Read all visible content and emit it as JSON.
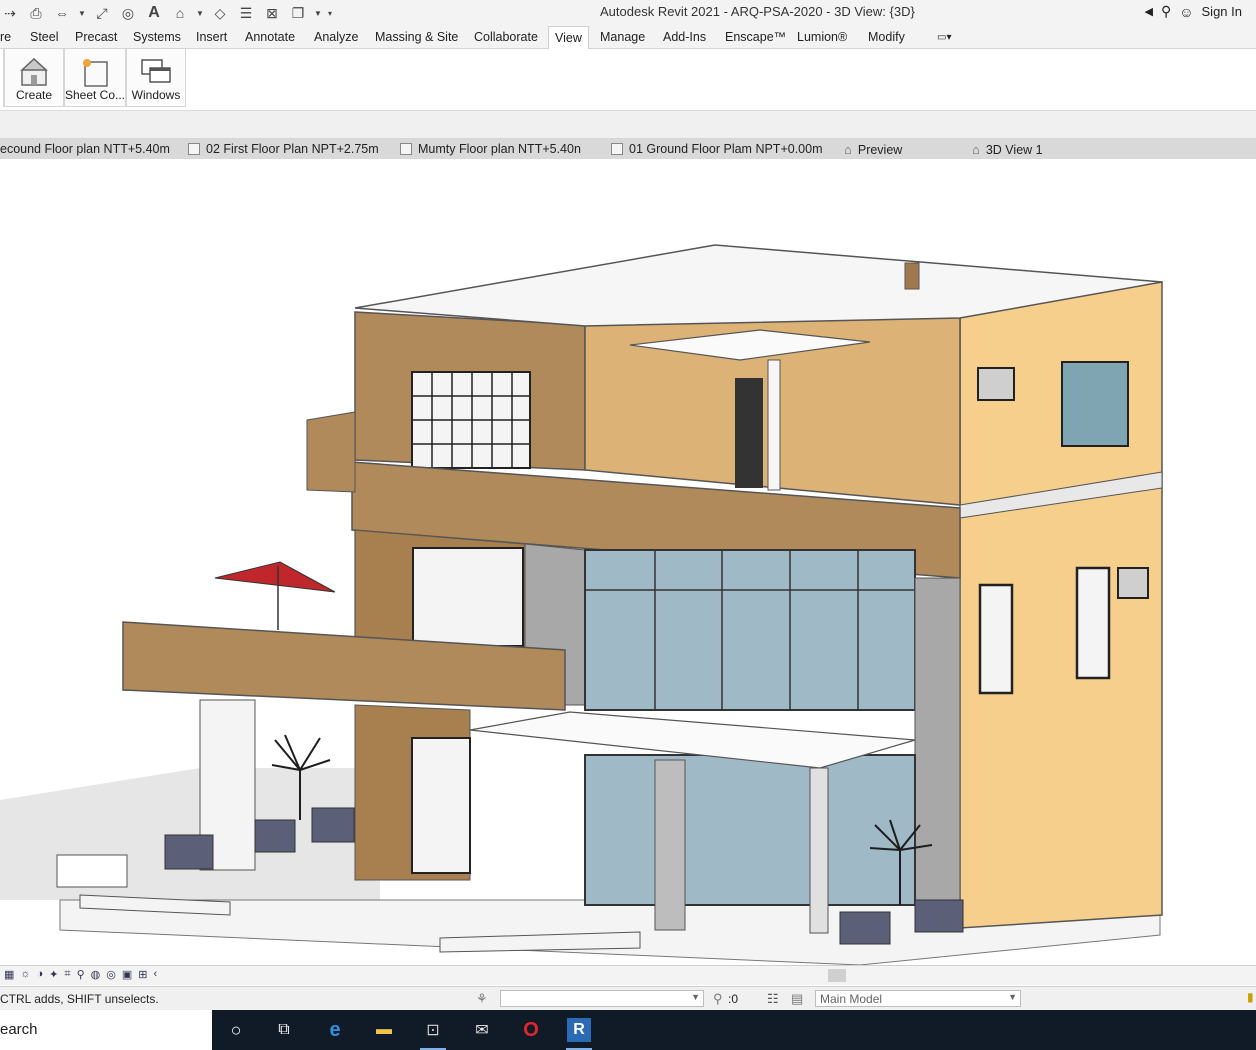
{
  "window": {
    "title": "Autodesk Revit 2021 - ARQ-PSA-2020 - 3D View: {3D}",
    "sign_in": "Sign In"
  },
  "ribbon_tabs": [
    "re",
    "Steel",
    "Precast",
    "Systems",
    "Insert",
    "Annotate",
    "Analyze",
    "Massing & Site",
    "Collaborate",
    "View",
    "Manage",
    "Add-Ins",
    "Enscape™",
    "Lumion®",
    "Modify"
  ],
  "active_tab": "View",
  "ribbon_buttons": {
    "create": "Create",
    "sheet": "Sheet Co...",
    "windows": "Windows"
  },
  "view_tabs": [
    "ecound Floor plan NTT+5.40m",
    "02 First Floor Plan NPT+2.75m",
    "Mumty  Floor plan NTT+5.40n",
    "01 Ground Floor Plam NPT+0.00m",
    "Preview",
    "3D View 1"
  ],
  "status": {
    "message": "CTRL adds, SHIFT unselects.",
    "filter_count": ":0",
    "model": "Main Model"
  },
  "taskbar": {
    "search": "earch"
  },
  "colors": {
    "ui_bg": "#f3f3f3",
    "wall_warm": "#f7cf8d",
    "wall_brown": "#b08a5a",
    "glass": "#9fb9c6",
    "taskbar": "#101b27"
  }
}
